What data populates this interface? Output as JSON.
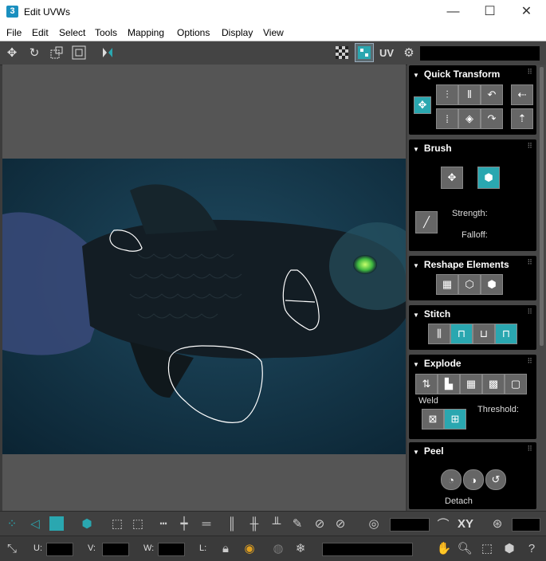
{
  "window": {
    "title": "Edit UVWs",
    "app_badge": "3"
  },
  "window_controls": {
    "minimize": "—",
    "maximize": "☐",
    "close": "✕"
  },
  "menu": [
    "File",
    "Edit",
    "Select",
    "Tools",
    "Mapping",
    "Options",
    "Display",
    "View"
  ],
  "toolbar_top": {
    "uv_label": "UV"
  },
  "panels": {
    "quick_transform": {
      "title": "Quick Transform"
    },
    "brush": {
      "title": "Brush",
      "strength_label": "Strength:",
      "falloff_label": "Falloff:"
    },
    "reshape": {
      "title": "Reshape Elements"
    },
    "stitch": {
      "title": "Stitch"
    },
    "explode": {
      "title": "Explode",
      "weld_label": "Weld",
      "threshold_label": "Threshold:"
    },
    "peel": {
      "title": "Peel",
      "detach_label": "Detach"
    }
  },
  "bottom_bar": {
    "xy_label": "XY",
    "u_label": "U:",
    "v_label": "V:",
    "w_label": "W:",
    "l_label": "L:"
  },
  "colors": {
    "accent": "#2aa7b0",
    "panel_bg": "#000000",
    "viewport_bg": "#555555"
  }
}
